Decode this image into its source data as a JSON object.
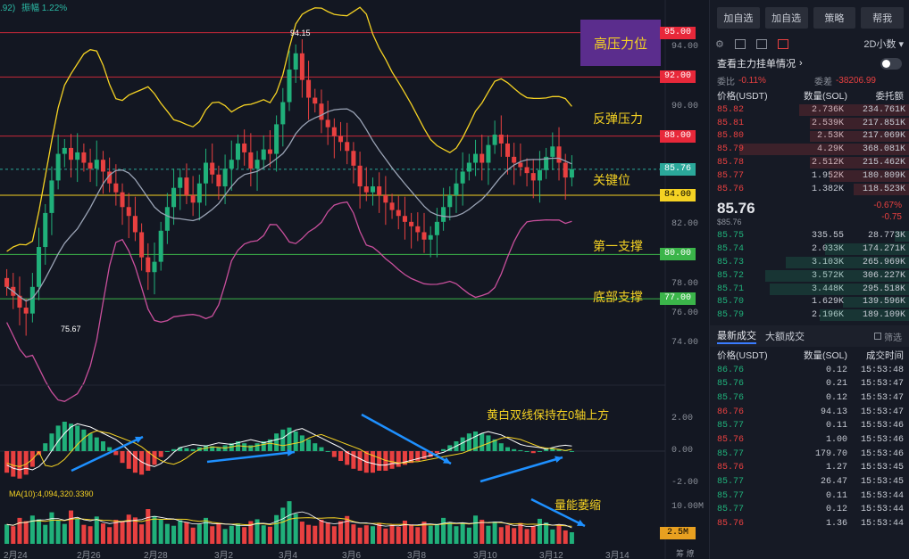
{
  "top_indicator": {
    "text": ".92)",
    "label": "振幅",
    "value": "1.22%"
  },
  "chart_data": {
    "type": "candlestick",
    "x_labels": [
      "2月24",
      "2月26",
      "2月28",
      "3月2",
      "3月4",
      "3月6",
      "3月8",
      "3月10",
      "3月12",
      "3月14"
    ],
    "y_ticks": [
      "94.00",
      "90.00",
      "82.00",
      "78.00",
      "76.00",
      "74.00"
    ],
    "ylim": [
      72,
      96
    ],
    "levels": [
      {
        "price": 95.0,
        "label": "95.00",
        "color": "#e8283a",
        "line": "#c8283a"
      },
      {
        "price": 92.0,
        "label": "92.00",
        "color": "#e8283a",
        "line": "#c8283a"
      },
      {
        "price": 88.0,
        "label": "88.00",
        "color": "#e8283a",
        "line": "#c8283a"
      },
      {
        "price": 84.0,
        "label": "84.00",
        "color": "#f5d223",
        "line": "#f5d223",
        "text_color": "#000000"
      },
      {
        "price": 80.0,
        "label": "80.00",
        "color": "#3bb54a",
        "line": "#3bb54a"
      },
      {
        "price": 77.0,
        "label": "77.00",
        "color": "#3bb54a",
        "line": "#3bb54a"
      }
    ],
    "current_price": {
      "value": 85.76,
      "label": "85.76",
      "color": "#2ba89a"
    },
    "high_label": "94.15",
    "low_label": "75.67",
    "annotations": {
      "resistance_box": "高压力位",
      "rebound": "反弹压力",
      "key": "关键位",
      "support1": "第一支撑",
      "bottom_support": "底部支撑",
      "macd_note": "黄白双线保持在0轴上方",
      "volume_note": "量能萎缩"
    },
    "macd_ticks": [
      "2.00",
      "0.00",
      "-2.00"
    ],
    "volume_legend": "MA(10):4,094,320.3390",
    "volume_ticks": [
      "10.00M"
    ],
    "volume_current": "2.5M",
    "close_series": [
      77.8,
      77.2,
      76.4,
      76.0,
      77.8,
      80.5,
      82.8,
      85.0,
      86.8,
      87.2,
      86.4,
      86.9,
      86.2,
      85.8,
      86.4,
      85.6,
      84.8,
      84.2,
      83.2,
      82.6,
      81.5,
      79.8,
      78.8,
      79.5,
      81.6,
      83.2,
      84.5,
      85.2,
      84.0,
      83.5,
      84.8,
      86.2,
      85.4,
      84.6,
      85.8,
      86.4,
      87.5,
      86.9,
      85.8,
      86.4,
      87.1,
      86.8,
      88.8,
      90.3,
      92.5,
      93.6,
      91.8,
      90.6,
      90.2,
      89.1,
      88.6,
      88.0,
      87.6,
      87.0,
      86.0,
      84.6,
      84.2,
      84.6,
      84.0,
      83.5,
      83.0,
      82.6,
      82.2,
      81.9,
      81.5,
      81.0,
      81.3,
      82.2,
      83.2,
      84.0,
      84.8,
      85.6,
      86.2,
      86.8,
      86.2,
      87.4,
      88.1,
      87.5,
      86.6,
      86.2,
      85.9,
      85.5,
      85.0,
      85.7,
      86.6,
      87.3,
      86.2,
      85.2,
      85.76
    ],
    "macd_hist": [
      -1.1,
      -1.3,
      -1.4,
      -1.2,
      -0.8,
      -0.2,
      0.4,
      0.9,
      1.3,
      1.5,
      1.4,
      1.3,
      1.1,
      0.9,
      0.7,
      0.5,
      0.2,
      -0.2,
      -0.6,
      -0.9,
      -1.1,
      -1.2,
      -1.0,
      -0.7,
      -0.3,
      0.0,
      0.1,
      0.2,
      0.15,
      0.1,
      0.2,
      0.3,
      0.25,
      0.2,
      0.3,
      0.4,
      0.5,
      0.4,
      0.3,
      0.4,
      0.5,
      0.6,
      0.9,
      1.1,
      1.2,
      1.0,
      0.8,
      0.6,
      0.4,
      0.2,
      0.0,
      -0.3,
      -0.5,
      -0.7,
      -0.9,
      -1.0,
      -1.1,
      -1.1,
      -1.0,
      -1.0,
      -0.9,
      -0.8,
      -0.7,
      -0.6,
      -0.5,
      -0.4,
      -0.3,
      -0.1,
      0.1,
      0.3,
      0.5,
      0.7,
      0.9,
      1.0,
      0.9,
      0.8,
      0.6,
      0.4,
      0.2,
      0.1,
      0.05,
      0.0,
      -0.1,
      0.0,
      0.1,
      0.15,
      0.1,
      0.05,
      0.0
    ],
    "volume": [
      4.2,
      3.8,
      5.6,
      4.9,
      6.1,
      5.3,
      4.1,
      6.8,
      5.0,
      4.3,
      7.2,
      5.4,
      4.1,
      3.8,
      5.9,
      4.4,
      3.6,
      5.2,
      4.8,
      6.3,
      5.7,
      4.2,
      7.5,
      6.0,
      5.2,
      4.3,
      3.9,
      5.1,
      4.7,
      3.5,
      4.2,
      5.6,
      3.8,
      4.5,
      3.2,
      3.9,
      4.4,
      3.6,
      4.9,
      5.3,
      4.0,
      3.7,
      6.2,
      7.8,
      9.2,
      6.5,
      4.8,
      4.1,
      3.9,
      5.2,
      4.6,
      3.8,
      4.9,
      6.0,
      4.2,
      3.5,
      4.0,
      3.8,
      4.5,
      3.3,
      4.1,
      3.7,
      5.0,
      4.2,
      3.6,
      4.8,
      3.9,
      4.3,
      5.6,
      4.7,
      3.8,
      4.4,
      3.5,
      6.1,
      5.2,
      3.9,
      4.8,
      3.6,
      4.0,
      3.4,
      4.5,
      3.2,
      3.8,
      5.4,
      4.6,
      3.1,
      4.2,
      2.9,
      2.5
    ]
  },
  "panel": {
    "buttons": [
      "加自选",
      "加自选",
      "策略",
      "帮我"
    ],
    "interval": "2D小数",
    "orderbook_title": "查看主力挂单情况",
    "ratio_label": "委比",
    "ratio_value": "-0.11%",
    "diff_label": "委差",
    "diff_value": "-38206.99",
    "headers": [
      "价格(USDT)",
      "数量(SOL)",
      "委托额"
    ],
    "asks": [
      {
        "price": "85.82",
        "qty": "2.736K",
        "amount": "234.761K",
        "depth": 0.55
      },
      {
        "price": "85.81",
        "qty": "2.539K",
        "amount": "217.851K",
        "depth": 0.5
      },
      {
        "price": "85.80",
        "qty": "2.53K",
        "amount": "217.069K",
        "depth": 0.5
      },
      {
        "price": "85.79",
        "qty": "4.29K",
        "amount": "368.081K",
        "depth": 0.85
      },
      {
        "price": "85.78",
        "qty": "2.512K",
        "amount": "215.462K",
        "depth": 0.5
      },
      {
        "price": "85.77",
        "qty": "1.952K",
        "amount": "180.809K",
        "depth": 0.4
      },
      {
        "price": "85.76",
        "qty": "1.382K",
        "amount": "118.523K",
        "depth": 0.28
      }
    ],
    "last_price": "85.76",
    "last_sub": "$85.76",
    "last_change_pct": "-0.67%",
    "last_change": "-0.75",
    "bids": [
      {
        "price": "85.75",
        "qty": "335.55",
        "amount": "28.773K",
        "depth": 0.07
      },
      {
        "price": "85.74",
        "qty": "2.033K",
        "amount": "174.271K",
        "depth": 0.42
      },
      {
        "price": "85.73",
        "qty": "3.103K",
        "amount": "265.969K",
        "depth": 0.62
      },
      {
        "price": "85.72",
        "qty": "3.572K",
        "amount": "306.227K",
        "depth": 0.72
      },
      {
        "price": "85.71",
        "qty": "3.448K",
        "amount": "295.518K",
        "depth": 0.7
      },
      {
        "price": "85.70",
        "qty": "1.629K",
        "amount": "139.596K",
        "depth": 0.33
      },
      {
        "price": "85.79",
        "qty": "2.196K",
        "amount": "189.109K",
        "depth": 0.45
      }
    ],
    "trade_tabs": [
      "最新成交",
      "大额成交"
    ],
    "trade_checkbox": "筛选",
    "trade_headers": [
      "价格(USDT)",
      "数量(SOL)",
      "成交时间"
    ],
    "trades": [
      {
        "price": "86.76",
        "qty": "0.12",
        "time": "15:53:48",
        "side": "buy"
      },
      {
        "price": "85.76",
        "qty": "0.21",
        "time": "15:53:47",
        "side": "buy"
      },
      {
        "price": "85.76",
        "qty": "0.12",
        "time": "15:53:47",
        "side": "buy"
      },
      {
        "price": "86.76",
        "qty": "94.13",
        "time": "15:53:47",
        "side": "sell"
      },
      {
        "price": "85.77",
        "qty": "0.11",
        "time": "15:53:46",
        "side": "buy"
      },
      {
        "price": "85.76",
        "qty": "1.00",
        "time": "15:53:46",
        "side": "sell"
      },
      {
        "price": "85.77",
        "qty": "179.70",
        "time": "15:53:46",
        "side": "buy"
      },
      {
        "price": "85.76",
        "qty": "1.27",
        "time": "15:53:45",
        "side": "sell"
      },
      {
        "price": "85.77",
        "qty": "26.47",
        "time": "15:53:45",
        "side": "buy"
      },
      {
        "price": "85.77",
        "qty": "0.11",
        "time": "15:53:44",
        "side": "buy"
      },
      {
        "price": "85.77",
        "qty": "0.12",
        "time": "15:53:44",
        "side": "buy"
      },
      {
        "price": "85.76",
        "qty": "1.36",
        "time": "15:53:44",
        "side": "sell"
      }
    ],
    "corner_text": "筹 燎"
  },
  "colors": {
    "up": "#20b07a",
    "down": "#e84040",
    "bg": "#131722",
    "boll": "#f5d223",
    "boll_low": "#c94f9c",
    "mid": "#9aa3b5"
  }
}
